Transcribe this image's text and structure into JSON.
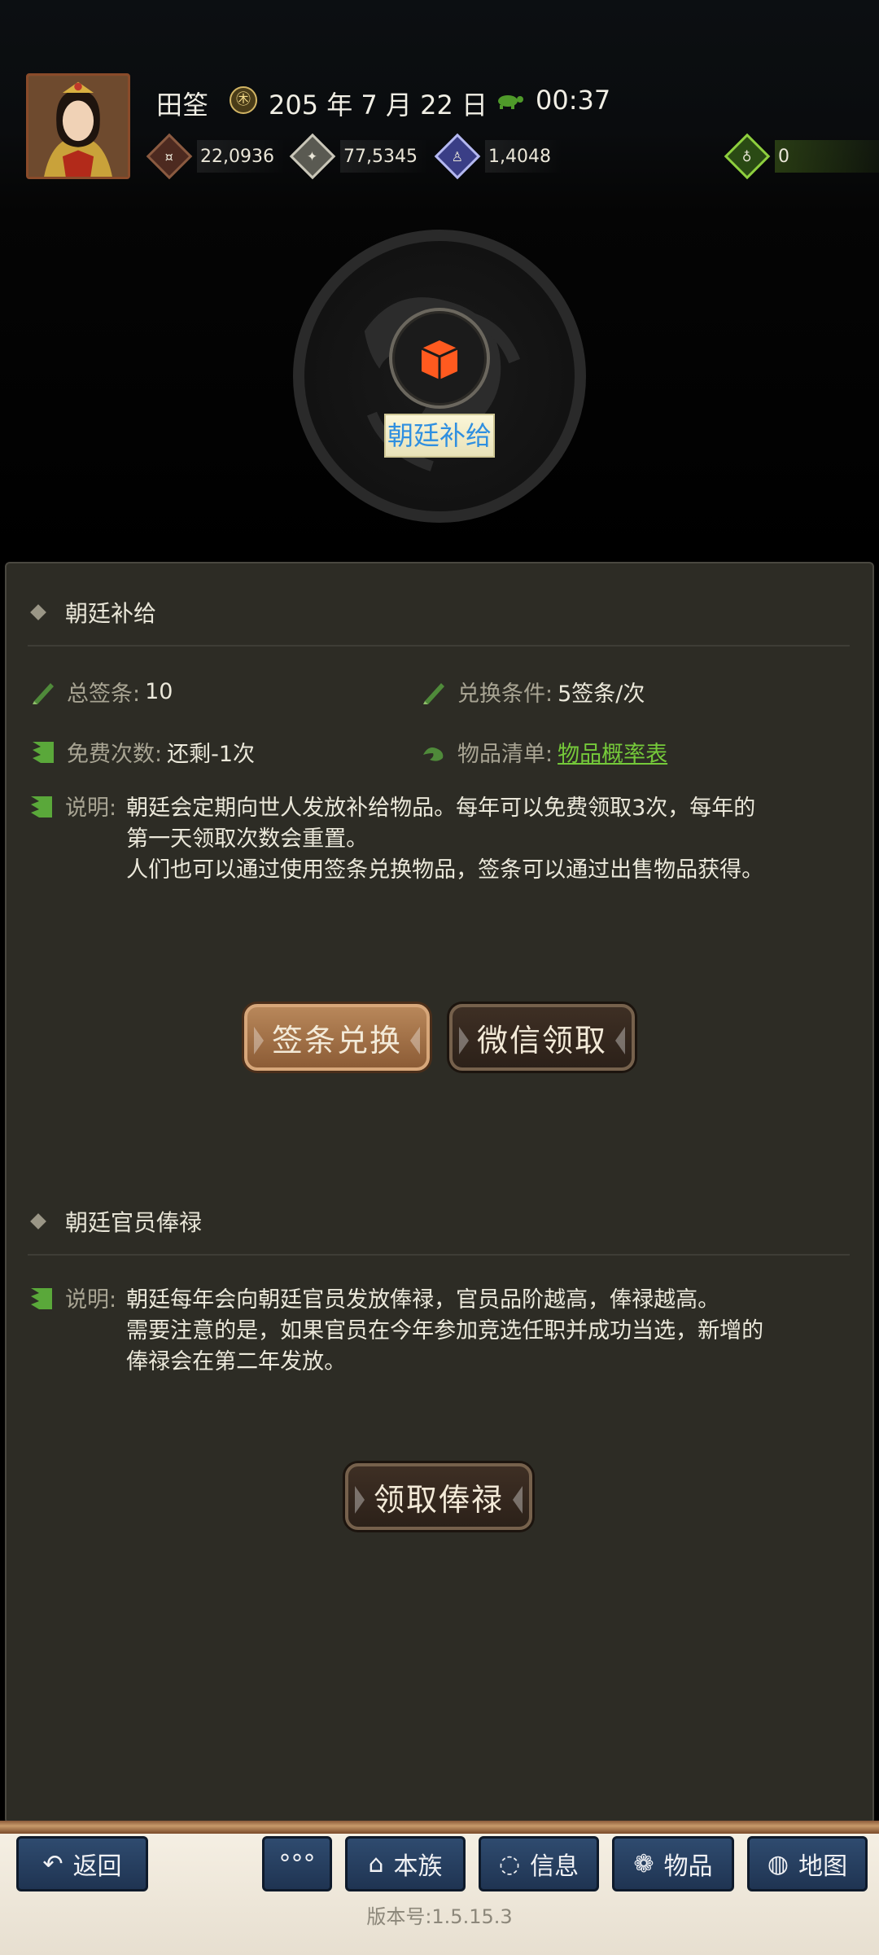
{
  "header": {
    "name": "田筌",
    "date": "205 年 7 月 22 日",
    "time": "00:37",
    "resources": [
      {
        "id": "copper",
        "value": "22,0936",
        "icon": "coin-bag-icon"
      },
      {
        "id": "silver",
        "value": "77,5345",
        "icon": "grain-icon"
      },
      {
        "id": "purple",
        "value": "1,4048",
        "icon": "soldier-icon"
      },
      {
        "id": "green",
        "value": "0",
        "icon": "money-bag-icon"
      }
    ],
    "feature_label": "朝廷补给"
  },
  "supply_section": {
    "title": "朝廷补给",
    "total_tickets_label": "总签条:",
    "total_tickets_value": "10",
    "exchange_label": "兑换条件:",
    "exchange_value": "5签条/次",
    "free_label": "免费次数:",
    "free_value": "还剩-1次",
    "items_label": "物品清单:",
    "items_link": "物品概率表",
    "desc_label": "说明:",
    "desc_line1": "朝廷会定期向世人发放补给物品。每年可以免费领取3次，每年的第一天领取次数会重置。",
    "desc_line2": "人们也可以通过使用签条兑换物品，签条可以通过出售物品获得。",
    "btn_exchange": "签条兑换",
    "btn_wechat": "微信领取"
  },
  "salary_section": {
    "title": "朝廷官员俸禄",
    "desc_label": "说明:",
    "desc_line1": "朝廷每年会向朝廷官员发放俸禄，官员品阶越高，俸禄越高。",
    "desc_line2": "需要注意的是，如果官员在今年参加竞选任职并成功当选，新增的俸禄会在第二年发放。",
    "btn_claim": "领取俸禄"
  },
  "nav": {
    "back": "返回",
    "more": "°°°",
    "clan": "本族",
    "info": "信息",
    "items": "物品",
    "map": "地图"
  },
  "version": "版本号:1.5.15.3",
  "colors": {
    "panel_bg": "#2d2c25",
    "link_green": "#75c93a",
    "label_blue": "#2f8fe0",
    "nav_button": "#2f4b6f"
  }
}
